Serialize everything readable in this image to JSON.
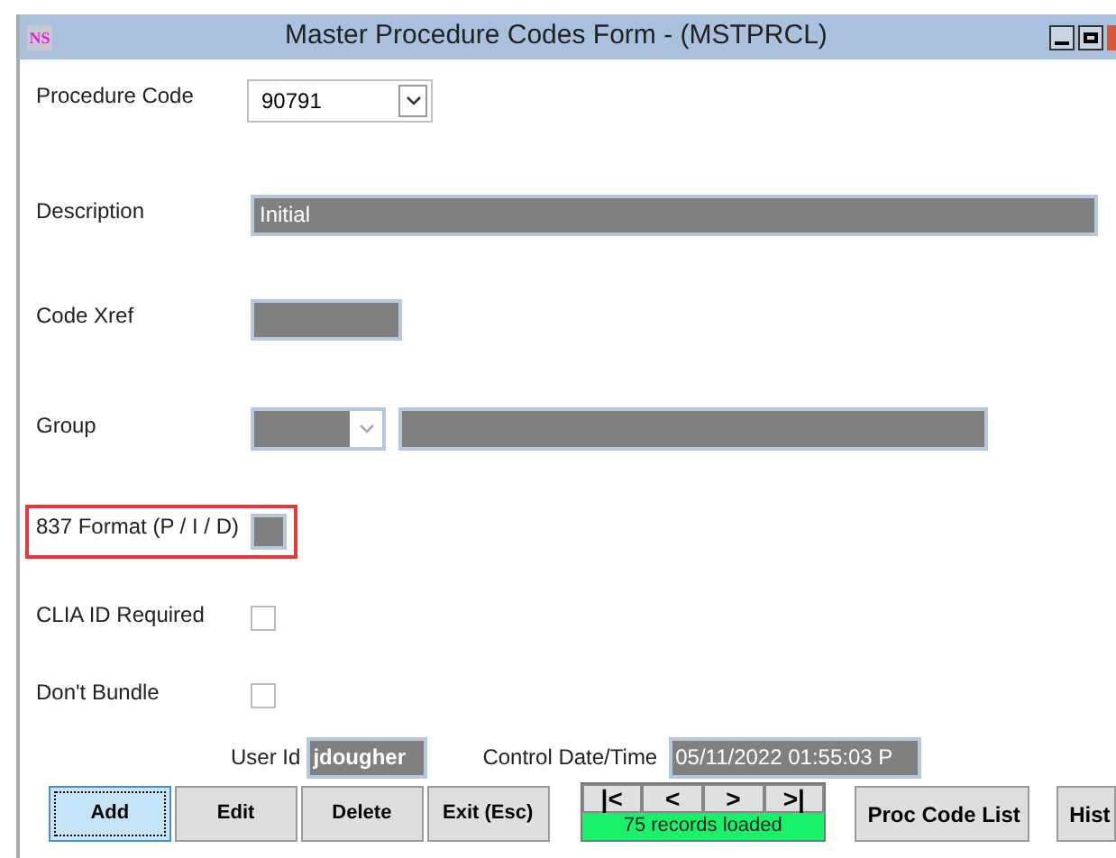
{
  "window": {
    "title": "Master Procedure Codes Form - (MSTPRCL)",
    "logo": "NS"
  },
  "fields": [
    {
      "kind": "combo",
      "label": "Procedure Code",
      "value": "90791"
    },
    {
      "kind": "text",
      "label": "Description",
      "value": "Initial"
    },
    {
      "kind": "text_short",
      "label": "Code Xref"
    },
    {
      "kind": "combo_text",
      "label": "Group"
    },
    {
      "kind": "small",
      "label": "837 Format (P / I / D)",
      "highlighted": true
    },
    {
      "kind": "checkbox",
      "label": "CLIA ID Required",
      "checked": false
    },
    {
      "kind": "checkbox",
      "label": "Don't Bundle",
      "checked": false
    }
  ],
  "user_id": {
    "label": "User Id",
    "value": "jdougher"
  },
  "control_datetime": {
    "label": "Control Date/Time",
    "value": "05/11/2022 01:55:03 P"
  },
  "buttons": [
    {
      "label": "Add",
      "focused": true
    },
    {
      "label": "Edit",
      "focused": false
    },
    {
      "label": "Delete",
      "focused": false
    },
    {
      "label": "Exit (Esc)",
      "focused": false
    }
  ],
  "navigator": {
    "buttons": [
      "|<",
      "<",
      ">",
      ">|"
    ],
    "status": "75 records loaded"
  },
  "extra_buttons": [
    "Proc Code List",
    "Hist"
  ]
}
